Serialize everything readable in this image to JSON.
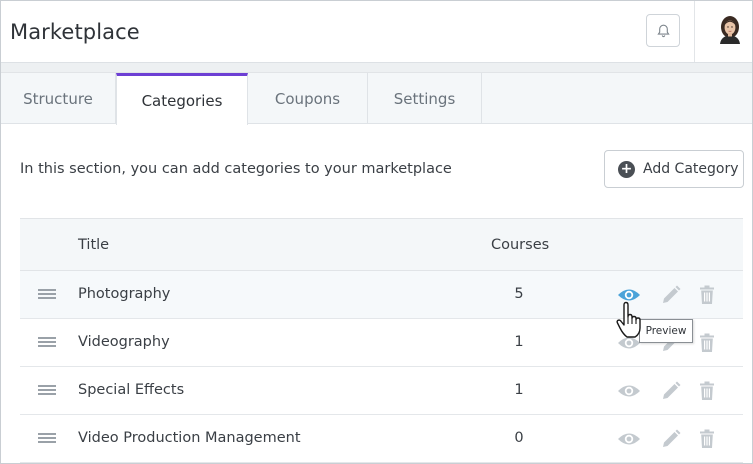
{
  "header": {
    "title": "Marketplace",
    "bell_icon": "bell-icon",
    "avatar_icon": "user-avatar"
  },
  "tabs": [
    {
      "label": "Structure",
      "active": false
    },
    {
      "label": "Categories",
      "active": true
    },
    {
      "label": "Coupons",
      "active": false
    },
    {
      "label": "Settings",
      "active": false
    }
  ],
  "content": {
    "intro": "In this section, you can add categories to your marketplace",
    "add_button_label": "Add Category"
  },
  "table": {
    "columns": [
      "Title",
      "Courses"
    ],
    "rows": [
      {
        "title": "Photography",
        "courses": "5"
      },
      {
        "title": "Videography",
        "courses": "1"
      },
      {
        "title": "Special Effects",
        "courses": "1"
      },
      {
        "title": "Video Production Management",
        "courses": "0"
      }
    ]
  },
  "tooltip": "Preview",
  "colors": {
    "accent": "#6d3fd4",
    "eye_active": "#4ba3d9",
    "icon_muted": "#c4cacf"
  }
}
